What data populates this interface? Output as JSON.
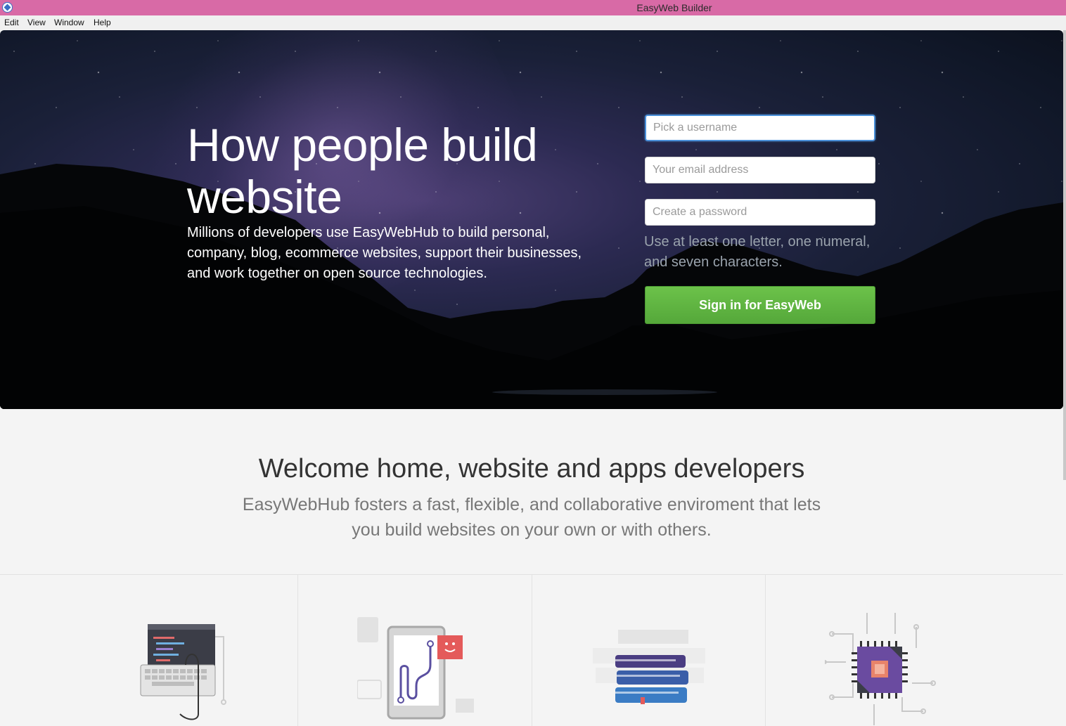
{
  "window": {
    "title": "EasyWeb Builder"
  },
  "menu": {
    "items": [
      "Edit",
      "View",
      "Window",
      "Help"
    ]
  },
  "hero": {
    "title": "How people build website",
    "description": "Millions of developers use EasyWebHub to build personal, company, blog, ecommerce websites, support their businesses, and work together on open source technologies."
  },
  "signup": {
    "username_placeholder": "Pick a username",
    "email_placeholder": "Your email address",
    "password_placeholder": "Create a password",
    "hint": "Use at least one letter, one numeral, and seven characters.",
    "button_label": "Sign in for EasyWeb"
  },
  "welcome": {
    "title": "Welcome home, website and apps developers",
    "subtitle": "EasyWebHub fosters a fast, flexible, and collaborative enviroment that lets you build websites on your own or with others."
  },
  "features": [
    {
      "icon": "code-keyboard-icon"
    },
    {
      "icon": "mobile-chat-icon"
    },
    {
      "icon": "books-icon"
    },
    {
      "icon": "chip-icon"
    }
  ]
}
